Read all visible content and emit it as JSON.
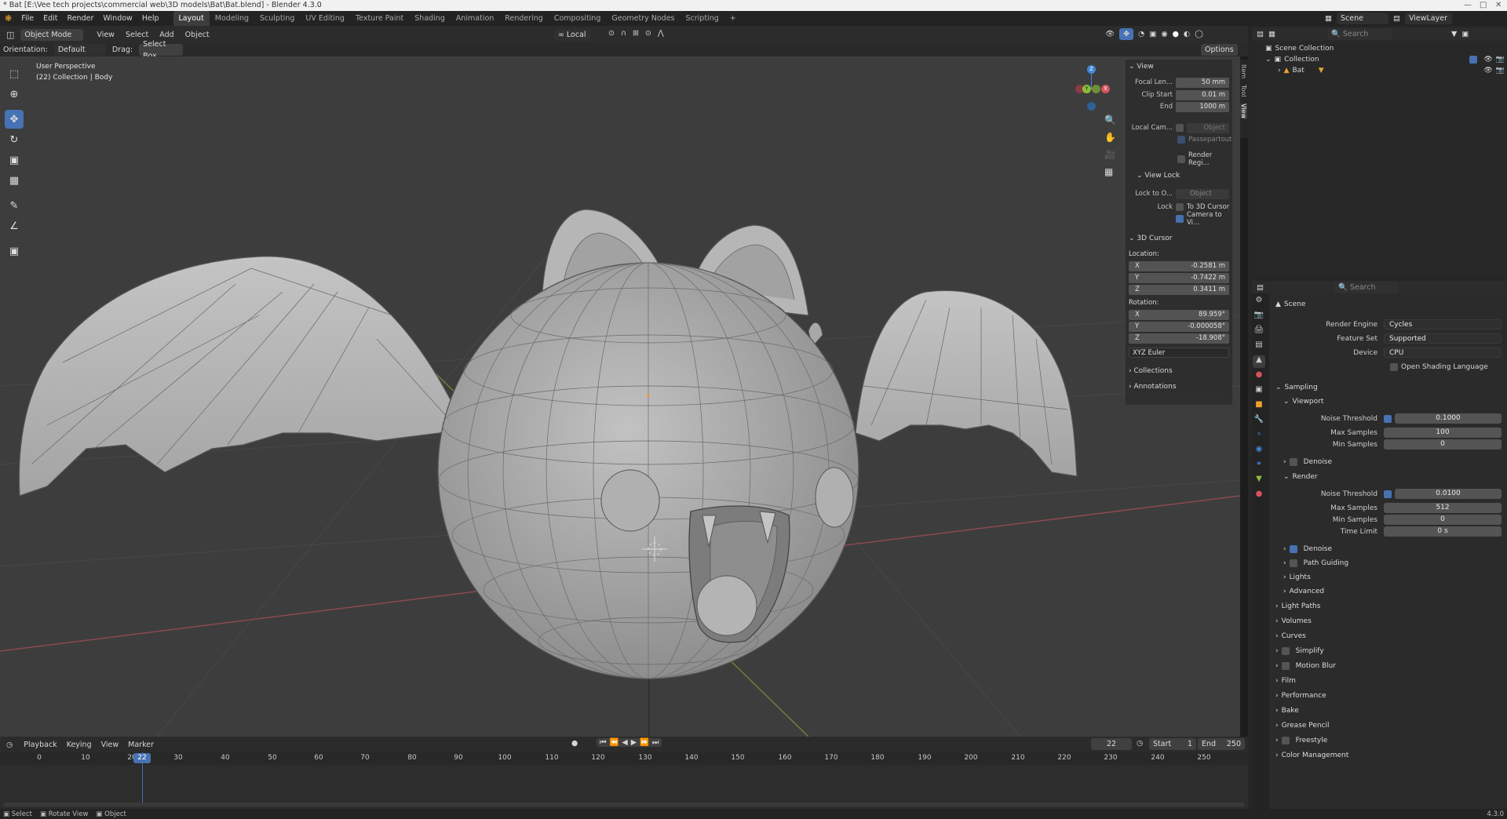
{
  "titlebar": {
    "title": "* Bat [E:\\Vee tech projects\\commercial web\\3D models\\Bat\\Bat.blend] - Blender 4.3.0"
  },
  "menu": {
    "items": [
      "File",
      "Edit",
      "Render",
      "Window",
      "Help"
    ]
  },
  "workspaces": [
    "Layout",
    "Modeling",
    "Sculpting",
    "UV Editing",
    "Texture Paint",
    "Shading",
    "Animation",
    "Rendering",
    "Compositing",
    "Geometry Nodes",
    "Scripting",
    "+"
  ],
  "scene": {
    "label": "Scene",
    "view_layer": "ViewLayer"
  },
  "viewport_header": {
    "mode": "Object Mode",
    "menus": [
      "View",
      "Select",
      "Add",
      "Object"
    ],
    "transform_orientation": "Local",
    "options": "Options"
  },
  "tool_header": {
    "orientation_label": "Orientation:",
    "orientation_value": "Default",
    "drag_label": "Drag:",
    "drag_value": "Select Box"
  },
  "viewport": {
    "perspective": "User Perspective",
    "collection": "(22) Collection | Body"
  },
  "gizmo": {
    "z": "Z",
    "y": "Y",
    "x": "X"
  },
  "npanel": {
    "tabs": [
      "Item",
      "Tool",
      "View"
    ],
    "view_section": "View",
    "focal_label": "Focal Len...",
    "focal_value": "50 mm",
    "clip_start_label": "Clip Start",
    "clip_start_value": "0.01 m",
    "end_label": "End",
    "end_value": "1000 m",
    "local_cam_label": "Local Cam...",
    "local_cam_value": "Object",
    "passepartout": "Passepartout",
    "render_region": "Render Regi...",
    "view_lock_section": "View Lock",
    "lock_to_label": "Lock to O...",
    "lock_to_value": "Object",
    "lock_label": "Lock",
    "lock_3d_cursor": "To 3D Cursor",
    "camera_to_view": "Camera to Vi...",
    "cursor_section": "3D Cursor",
    "location_label": "Location:",
    "loc_x": "-0.2581 m",
    "loc_y": "-0.7422 m",
    "loc_z": "0.3411 m",
    "rotation_label": "Rotation:",
    "rot_x": "89.959°",
    "rot_y": "-0.000058°",
    "rot_z": "-18.908°",
    "rotation_mode": "XYZ Euler",
    "collections": "Collections",
    "annotations": "Annotations",
    "x": "X",
    "y": "Y",
    "z": "Z"
  },
  "outliner": {
    "search_placeholder": "Search",
    "scene_collection": "Scene Collection",
    "collection": "Collection",
    "object": "Bat"
  },
  "properties": {
    "search_placeholder": "Search",
    "scene": "Scene",
    "render_engine_label": "Render Engine",
    "render_engine_value": "Cycles",
    "feature_set_label": "Feature Set",
    "feature_set_value": "Supported",
    "device_label": "Device",
    "device_value": "CPU",
    "osl": "Open Shading Language",
    "sampling": "Sampling",
    "viewport": "Viewport",
    "noise_threshold_label": "Noise Threshold",
    "vp_noise_value": "0.1000",
    "max_samples_label": "Max Samples",
    "vp_max_samples": "100",
    "min_samples_label": "Min Samples",
    "vp_min_samples": "0",
    "denoise": "Denoise",
    "render": "Render",
    "r_noise_value": "0.0100",
    "r_max_samples": "512",
    "r_min_samples": "0",
    "time_limit_label": "Time Limit",
    "time_limit_value": "0 s",
    "path_guiding": "Path Guiding",
    "lights": "Lights",
    "advanced": "Advanced",
    "panels": [
      "Light Paths",
      "Volumes",
      "Curves",
      "Simplify",
      "Motion Blur",
      "Film",
      "Performance",
      "Bake",
      "Grease Pencil",
      "Freestyle",
      "Color Management"
    ]
  },
  "timeline": {
    "menus": [
      "Playback",
      "Keying",
      "View",
      "Marker"
    ],
    "current_frame": "22",
    "start_label": "Start",
    "start_value": "1",
    "end_label": "End",
    "end_value": "250",
    "ticks": [
      "0",
      "10",
      "20",
      "30",
      "40",
      "50",
      "60",
      "70",
      "80",
      "90",
      "100",
      "110",
      "120",
      "130",
      "140",
      "150",
      "160",
      "170",
      "180",
      "190",
      "200",
      "210",
      "220",
      "230",
      "240",
      "250"
    ],
    "playhead": "22"
  },
  "statusbar": {
    "select": "Select",
    "rotate_view": "Rotate View",
    "object": "Object",
    "version": "4.3.0"
  },
  "colors": {
    "accent": "#4772b3",
    "viewport_bg": "#3d3d3d",
    "x_axis": "#d6525c",
    "y_axis": "#8bbf3b",
    "z_axis": "#3f88d6"
  }
}
